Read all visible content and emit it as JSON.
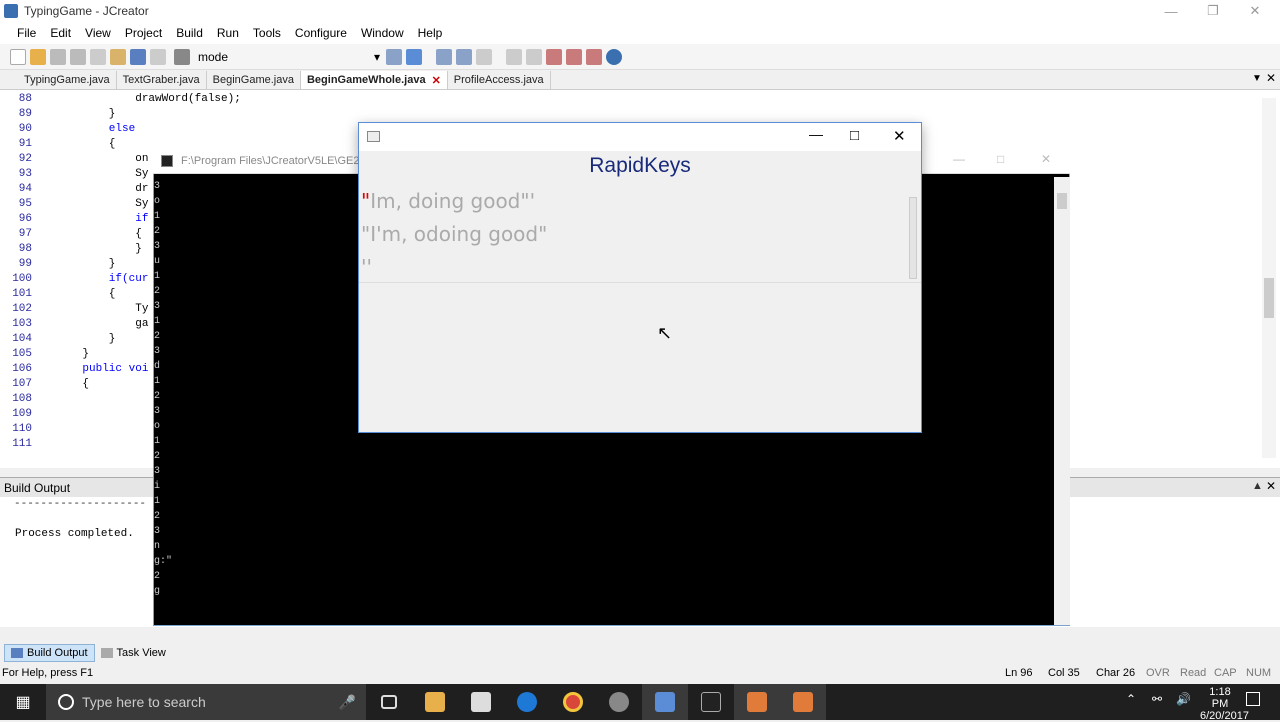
{
  "app": {
    "title": "TypingGame - JCreator",
    "menu": [
      "File",
      "Edit",
      "View",
      "Project",
      "Build",
      "Run",
      "Tools",
      "Configure",
      "Window",
      "Help"
    ],
    "toolbar": {
      "mode_label": "mode"
    },
    "tabs": [
      {
        "label": "TypingGame.java",
        "active": false
      },
      {
        "label": "TextGraber.java",
        "active": false
      },
      {
        "label": "BeginGame.java",
        "active": false
      },
      {
        "label": "BeginGameWhole.java",
        "active": true
      },
      {
        "label": "ProfileAccess.java",
        "active": false
      }
    ],
    "code": {
      "line_numbers": [
        "88",
        "89",
        "90",
        "91",
        "92",
        "93",
        "94",
        "95",
        "96",
        "97",
        "98",
        "99",
        "100",
        "101",
        "102",
        "103",
        "104",
        "105",
        "106",
        "107",
        "108",
        "109",
        "110",
        "111"
      ],
      "lines": [
        "            drawWord(false);",
        "        }",
        "        else",
        "        {",
        "",
        "            on",
        "            Sy",
        "            dr",
        "            Sy",
        "            if",
        "            {",
        "",
        "",
        "            }",
        "        }",
        "        if(cur",
        "        {",
        "            Ty",
        "            ga",
        "        }",
        "    }",
        "    public voi",
        "    {",
        ""
      ]
    },
    "build_output": {
      "title": "Build Output",
      "dashes": "--------------------",
      "message": "Process completed."
    },
    "bottom_tabs": [
      "Build Output",
      "Task View"
    ],
    "status": {
      "help": "For Help, press F1",
      "ln": "Ln 96",
      "col": "Col 35",
      "char": "Char 26",
      "ovr": "OVR",
      "read": "Read",
      "cap": "CAP",
      "num": "NUM"
    }
  },
  "console": {
    "path": "F:\\Program Files\\JCreatorV5LE\\GE20",
    "lines": [
      "3",
      "o",
      "1",
      "2",
      "3",
      "u",
      "1",
      "2",
      "3",
      "",
      "1",
      "2",
      "3",
      "d",
      "1",
      "2",
      "3",
      "o",
      "1",
      "2",
      "3",
      "i",
      "1",
      "2",
      "3",
      "n",
      "g:\"",
      "2",
      "g"
    ]
  },
  "rapidkeys": {
    "title": "RapidKeys",
    "lines": [
      {
        "first_char": "\"",
        "rest": "Im, doing good\"'"
      },
      {
        "first_char": "",
        "rest": "\"I'm, odoing good\""
      },
      {
        "first_char": "",
        "rest": "''"
      }
    ]
  },
  "taskbar": {
    "search_placeholder": "Type here to search",
    "time": "1:18 PM",
    "date": "6/20/2017"
  },
  "colors": {
    "keyword": "#0000ff",
    "line_number": "#2a2aa0",
    "rapidkeys_title": "#1a2a7a",
    "typed_error": "#e00000",
    "console_bg": "#000000",
    "taskbar_bg": "#1f1f1f"
  }
}
